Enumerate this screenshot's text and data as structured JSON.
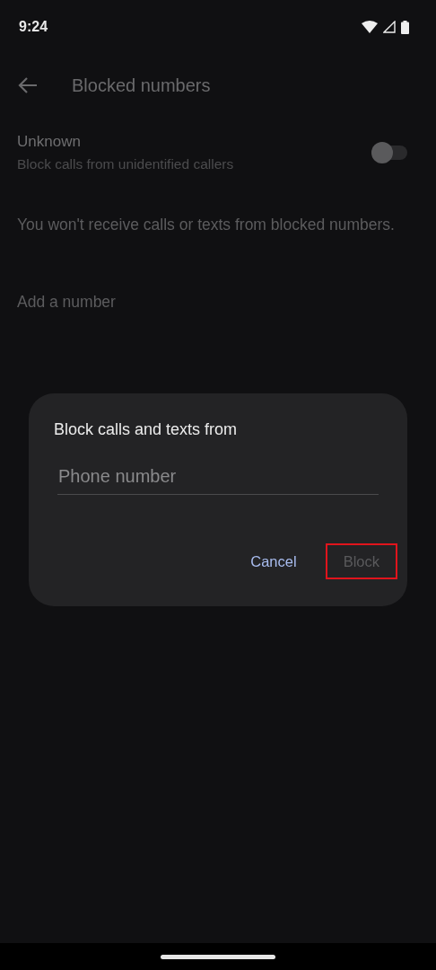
{
  "status_bar": {
    "time": "9:24"
  },
  "toolbar": {
    "title": "Blocked numbers"
  },
  "unknown_setting": {
    "title": "Unknown",
    "subtitle": "Block calls from unidentified callers",
    "on": false
  },
  "description": "You won't receive calls or texts from blocked numbers.",
  "add_number": "Add a number",
  "dialog": {
    "title": "Block calls and texts from",
    "field": {
      "placeholder": "Phone number"
    },
    "buttons": [
      {
        "label": "Cancel",
        "disabled": false,
        "highlighted": false
      },
      {
        "label": "Block",
        "disabled": true,
        "highlighted": true
      }
    ]
  }
}
